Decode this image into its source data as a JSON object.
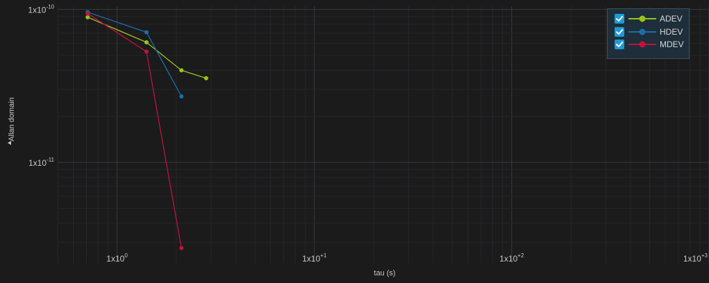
{
  "chart_data": {
    "type": "line",
    "xlabel": "tau (s)",
    "ylabel": "Allan domain",
    "x_scale": "log",
    "y_scale": "log",
    "xlim": [
      0.5,
      1000
    ],
    "ylim": [
      2.2e-12,
      1.05e-10
    ],
    "x_ticks": [
      {
        "value": 1,
        "base": "1x10",
        "exp": "0"
      },
      {
        "value": 10,
        "base": "1x10",
        "exp": "+1"
      },
      {
        "value": 100,
        "base": "1x10",
        "exp": "+2"
      },
      {
        "value": 1000,
        "base": "1x10",
        "exp": "+3"
      }
    ],
    "y_ticks": [
      {
        "value": 1e-10,
        "base": "1x10",
        "exp": "-10"
      },
      {
        "value": 1e-11,
        "base": "1x10",
        "exp": "-11"
      }
    ],
    "grid": true,
    "legend_position": "top-right",
    "series": [
      {
        "name": "ADEV",
        "color": "#9ac31c",
        "checked": true,
        "points": [
          [
            0.71,
            8.9e-11
          ],
          [
            1.41,
            6.1e-11
          ],
          [
            2.12,
            4e-11
          ],
          [
            2.83,
            3.55e-11
          ]
        ]
      },
      {
        "name": "HDEV",
        "color": "#1a6fa8",
        "checked": true,
        "points": [
          [
            0.71,
            9.6e-11
          ],
          [
            1.41,
            7.1e-11
          ],
          [
            2.12,
            2.7e-11
          ]
        ]
      },
      {
        "name": "MDEV",
        "color": "#c2123e",
        "checked": true,
        "points": [
          [
            0.71,
            9.4e-11
          ],
          [
            1.41,
            5.3e-11
          ],
          [
            2.12,
            2.75e-12
          ]
        ]
      }
    ]
  }
}
